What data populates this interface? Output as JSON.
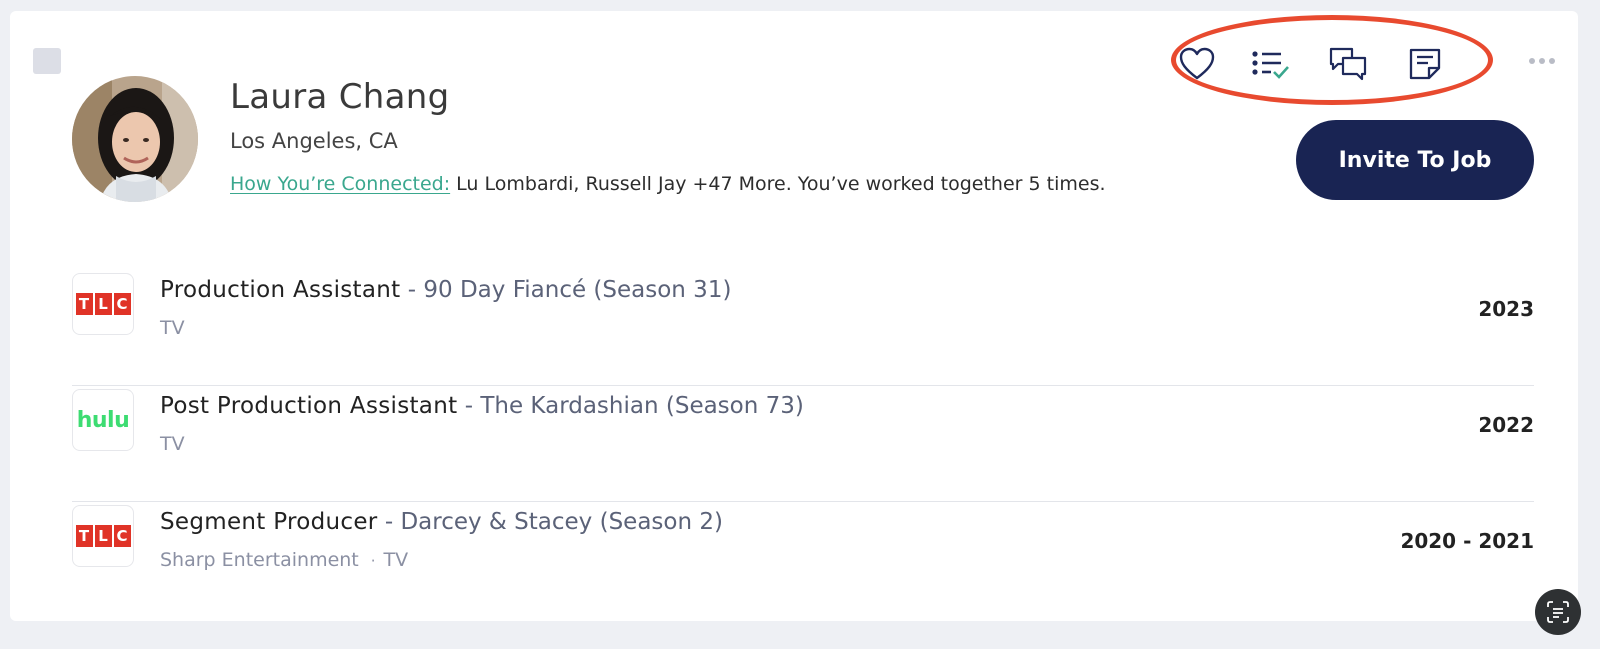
{
  "profile": {
    "name": "Laura Chang",
    "location": "Los Angeles, CA",
    "connected_label": "How You’re Connected:",
    "connected_text": "Lu Lombardi, Russell Jay +47 More. You’ve worked together 5 times."
  },
  "actions": {
    "icons": [
      "heart-icon",
      "checklist-icon",
      "chat-bubbles-icon",
      "note-icon",
      "more-dots-icon"
    ],
    "invite_label": "Invite To Job",
    "highlight_color": "#e84a2f"
  },
  "colors": {
    "primary_button": "#192453",
    "link": "#3aa78e",
    "tlc_red": "#e03327",
    "hulu_green": "#3ddc72"
  },
  "jobs": [
    {
      "logo": "TLC",
      "title": "Production Assistant",
      "show": "- 90 Day Fiancé (Season 31)",
      "company": "",
      "type": "TV",
      "years": "2023"
    },
    {
      "logo": "hulu",
      "title": "Post Production Assistant",
      "show": "- The Kardashian (Season 73)",
      "company": "",
      "type": "TV",
      "years": "2022"
    },
    {
      "logo": "TLC",
      "title": "Segment Producer",
      "show": "- Darcey & Stacey (Season 2)",
      "company": "Sharp Entertainment",
      "separator": "·",
      "type": "TV",
      "years": "2020 - 2021"
    }
  ]
}
